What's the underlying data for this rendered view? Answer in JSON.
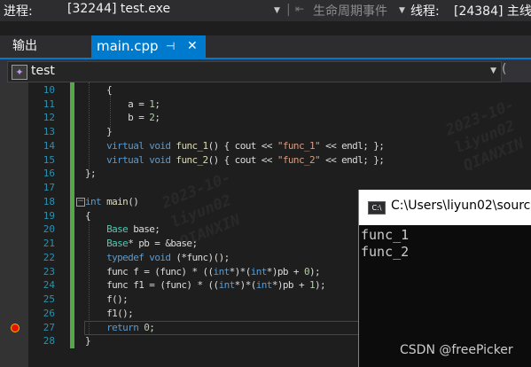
{
  "toolbar": {
    "process_label": "进程:",
    "process_value": "[32244] test.exe",
    "lifecycle_label": "生命周期事件",
    "thread_label": "线程:",
    "thread_value": "[24384] 主线"
  },
  "tabs": {
    "output": "输出",
    "active_file": "main.cpp",
    "pin_glyph": "⊣",
    "close_glyph": "✕"
  },
  "nav": {
    "scope": "test",
    "scope_icon": "class-icon",
    "right_glyph": "("
  },
  "editor": {
    "line_numbers": [
      "10",
      "11",
      "12",
      "13",
      "14",
      "15",
      "16",
      "17",
      "18",
      "19",
      "20",
      "21",
      "22",
      "23",
      "24",
      "25",
      "26",
      "27",
      "28"
    ],
    "breakpoint_line": "27",
    "watermark_lines": [
      "2023-10-",
      "liyun02",
      "QIANXIN"
    ]
  },
  "console": {
    "title": "C:\\Users\\liyun02\\sourc",
    "output_lines": [
      "func_1",
      "func_2"
    ]
  },
  "credit": "CSDN @freePicker",
  "colors": {
    "accent": "#007acc",
    "keyword": "#569cd6",
    "string": "#d69d85",
    "line_number": "#2b91af",
    "change_bar": "#57a64a"
  }
}
